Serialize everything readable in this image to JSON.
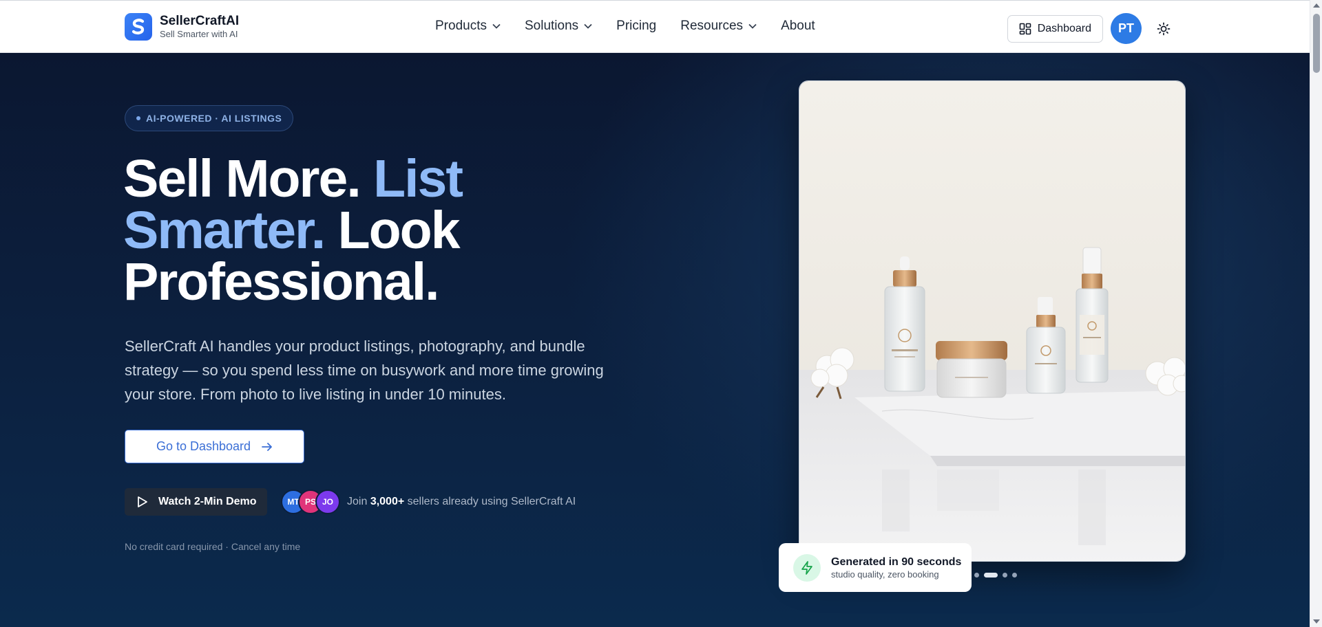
{
  "brand": {
    "name": "SellerCraftAI",
    "tagline": "Sell Smarter with AI",
    "logo_letter": "S",
    "color": "#2563eb"
  },
  "nav": {
    "items": [
      {
        "label": "Products",
        "has_dropdown": true
      },
      {
        "label": "Solutions",
        "has_dropdown": true
      },
      {
        "label": "Pricing",
        "has_dropdown": false
      },
      {
        "label": "Resources",
        "has_dropdown": true
      },
      {
        "label": "About",
        "has_dropdown": false
      }
    ],
    "dashboard_label": "Dashboard",
    "avatar_initials": "PT",
    "theme_icon": "sun-icon"
  },
  "hero": {
    "badge": "AI-POWERED · AI LISTINGS",
    "headline": {
      "part1": "Sell More. ",
      "accent": "List Smarter.",
      "part2": " Look Professional."
    },
    "description": "SellerCraft AI handles your product listings, photography, and bundle strategy — so you spend less time on busywork and more time growing your store. From photo to live listing in under 10 minutes.",
    "cta_label": "Go to Dashboard",
    "demo_label": "Watch 2-Min Demo",
    "social": {
      "avatars": [
        {
          "initials": "MT",
          "color": "#2d6ee0"
        },
        {
          "initials": "PS",
          "color": "#e0347a"
        },
        {
          "initials": "JO",
          "color": "#7c3aed"
        }
      ],
      "prefix": "Join",
      "count": "3,000+",
      "suffix": "sellers already using SellerCraft AI"
    },
    "fine_print": "No credit card required · Cancel any time"
  },
  "showcase": {
    "toast_title": "Generated in 90 seconds",
    "toast_subtitle": "studio quality, zero booking",
    "slides": 4,
    "active_slide": 2
  }
}
